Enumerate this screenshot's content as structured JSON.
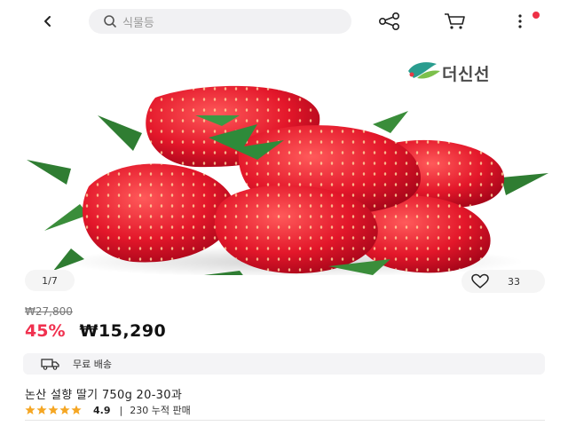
{
  "header": {
    "back_icon": "chevron-left-icon",
    "search": {
      "placeholder": "식물등",
      "icon": "search-icon"
    },
    "share_icon": "share-icon",
    "cart_icon": "cart-icon",
    "more_icon": "more-vertical-icon",
    "notification_color": "#ee3046"
  },
  "gallery": {
    "brand_name": "더신선",
    "page_indicator": "1/7",
    "like_count": "33"
  },
  "price": {
    "original": "₩27,800",
    "discount": "45%",
    "sale": "₩15,290",
    "discount_color": "#f0314f"
  },
  "shipping": {
    "label": "무료 배송",
    "icon": "truck-icon"
  },
  "product": {
    "title": "논산 설향 딸기 750g 20-30과",
    "rating_score": "4.9",
    "rating_separator": "|",
    "review_text": "230 누적 판매",
    "star_count": 5,
    "star_color": "#f5a623"
  }
}
